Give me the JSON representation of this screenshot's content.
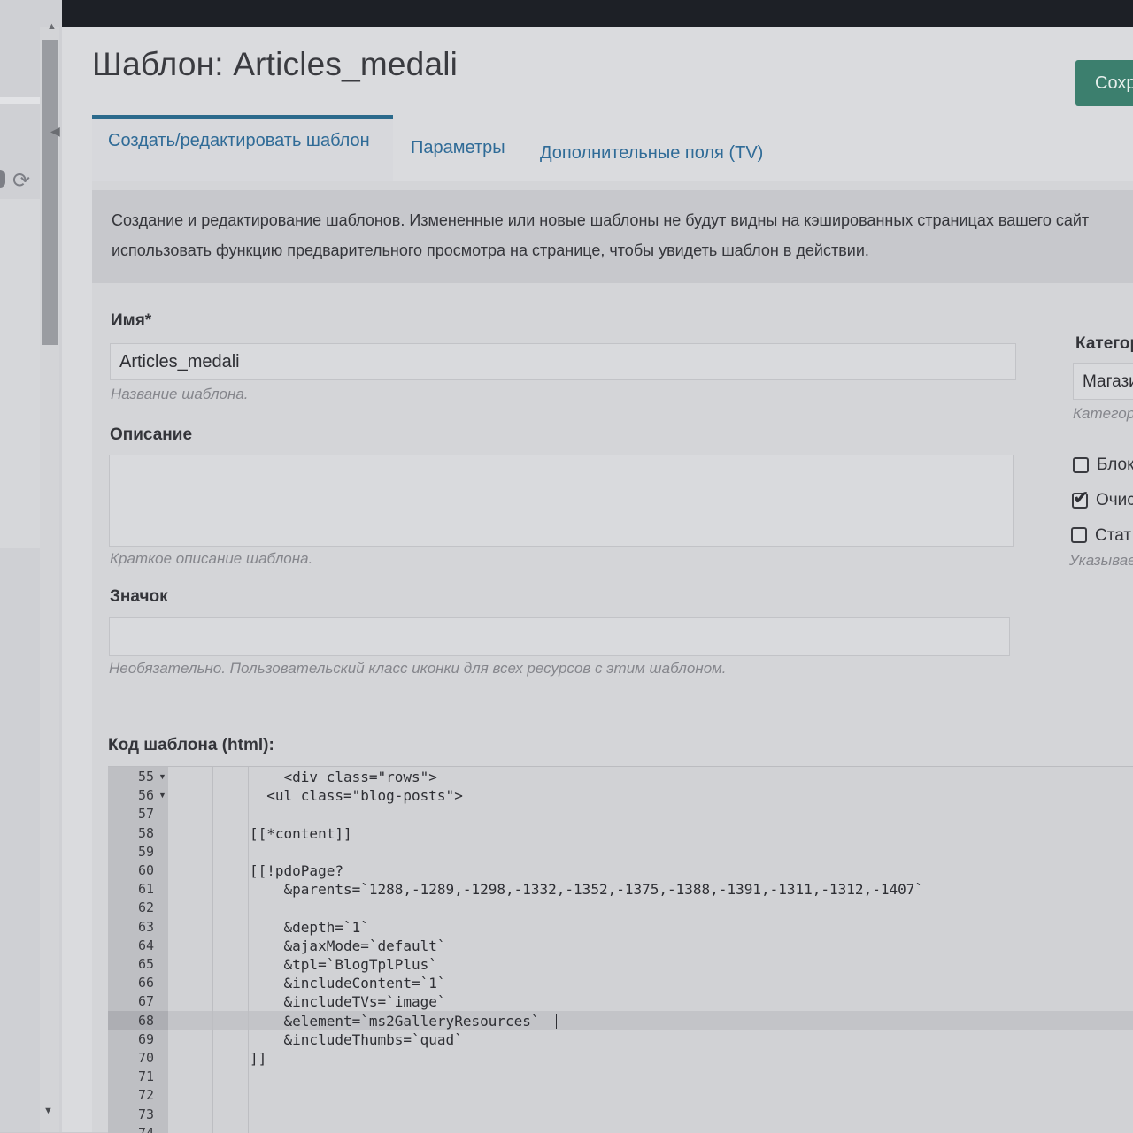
{
  "title": "Шаблон: Articles_medali",
  "save_button": "Сохр",
  "tabs": [
    "Создать/редактировать шаблон",
    "Параметры",
    "Дополнительные поля (TV)"
  ],
  "intro": "Создание и редактирование шаблонов. Измененные или новые шаблоны не будут видны на кэшированных страницах вашего сайт использовать функцию предварительного просмотра на странице, чтобы увидеть шаблон в действии.",
  "form": {
    "name_label": "Имя*",
    "name_value": "Articles_medali",
    "name_hint": "Название шаблона.",
    "description_label": "Описание",
    "description_value": "",
    "description_hint": "Краткое описание шаблона.",
    "icon_label": "Значок",
    "icon_value": "",
    "icon_hint": "Необязательно. Пользовательский класс иконки для всех ресурсов с этим шаблоном."
  },
  "right": {
    "category_label": "Категор",
    "category_value": "Магази",
    "category_hint": "Категор",
    "checkboxes": [
      {
        "label": "Блок",
        "checked": false
      },
      {
        "label": "Очис",
        "checked": true
      },
      {
        "label": "Стат",
        "checked": false
      }
    ],
    "hint": "Указывае"
  },
  "code_label": "Код шаблона (html):",
  "code": {
    "active_line": "68",
    "lines": [
      {
        "n": "55",
        "fold": true,
        "text": "    <div class=\"rows\">"
      },
      {
        "n": "56",
        "fold": true,
        "text": "  <ul class=\"blog-posts\">"
      },
      {
        "n": "57",
        "fold": false,
        "text": ""
      },
      {
        "n": "58",
        "fold": false,
        "text": "[[*content]]"
      },
      {
        "n": "59",
        "fold": false,
        "text": ""
      },
      {
        "n": "60",
        "fold": false,
        "text": "[[!pdoPage?"
      },
      {
        "n": "61",
        "fold": false,
        "text": "    &parents=`1288,-1289,-1298,-1332,-1352,-1375,-1388,-1391,-1311,-1312,-1407`"
      },
      {
        "n": "62",
        "fold": false,
        "text": ""
      },
      {
        "n": "63",
        "fold": false,
        "text": "    &depth=`1`"
      },
      {
        "n": "64",
        "fold": false,
        "text": "    &ajaxMode=`default`"
      },
      {
        "n": "65",
        "fold": false,
        "text": "    &tpl=`BlogTplPlus`"
      },
      {
        "n": "66",
        "fold": false,
        "text": "    &includeContent=`1`"
      },
      {
        "n": "67",
        "fold": false,
        "text": "    &includeTVs=`image`"
      },
      {
        "n": "68",
        "fold": false,
        "text": "    &element=`ms2GalleryResources`"
      },
      {
        "n": "69",
        "fold": false,
        "text": "    &includeThumbs=`quad`"
      },
      {
        "n": "70",
        "fold": false,
        "text": "]]"
      },
      {
        "n": "71",
        "fold": false,
        "text": ""
      },
      {
        "n": "72",
        "fold": false,
        "text": ""
      },
      {
        "n": "73",
        "fold": false,
        "text": ""
      },
      {
        "n": "74",
        "fold": false,
        "text": ""
      }
    ]
  }
}
